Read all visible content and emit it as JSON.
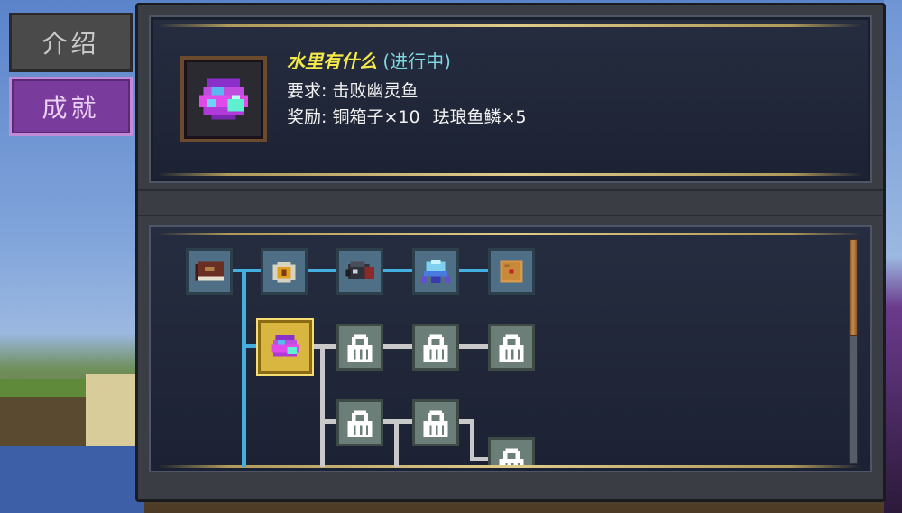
{
  "tabs": [
    {
      "label": "介绍",
      "active": false
    },
    {
      "label": "成就",
      "active": true
    }
  ],
  "achievement": {
    "title": "水里有什么",
    "status_open": "(",
    "status": "进行中",
    "status_close": ")",
    "requirement_label": "要求:",
    "requirement": "击败幽灵鱼",
    "reward_label": "奖励:",
    "reward_items": [
      "铜箱子×10",
      "珐琅鱼鳞×5"
    ],
    "icon": "enamel-fish-scale-icon"
  },
  "tree": {
    "nodes": [
      {
        "name": "book",
        "icon": "book-icon",
        "state": "unlocked"
      },
      {
        "name": "compass",
        "icon": "compass-icon",
        "state": "unlocked"
      },
      {
        "name": "fish",
        "icon": "fish-icon",
        "state": "unlocked"
      },
      {
        "name": "crystal-crab",
        "icon": "crystal-creature-icon",
        "state": "unlocked"
      },
      {
        "name": "letter",
        "icon": "letter-icon",
        "state": "unlocked"
      },
      {
        "name": "current",
        "icon": "enamel-fish-scale-icon",
        "state": "selected"
      },
      {
        "name": "locked-1",
        "icon": "lock-icon",
        "state": "locked"
      },
      {
        "name": "locked-2",
        "icon": "lock-icon",
        "state": "locked"
      },
      {
        "name": "locked-3",
        "icon": "lock-icon",
        "state": "locked"
      },
      {
        "name": "locked-4",
        "icon": "lock-icon",
        "state": "locked"
      },
      {
        "name": "locked-5",
        "icon": "lock-icon",
        "state": "locked"
      },
      {
        "name": "locked-6",
        "icon": "lock-icon",
        "state": "locked"
      }
    ]
  },
  "colors": {
    "title": "#f5e94a",
    "status": "#7fd6e0",
    "unlocked_line": "#44aee0",
    "locked_line": "#c9c9c9",
    "selected_frame": "#d9b640"
  }
}
